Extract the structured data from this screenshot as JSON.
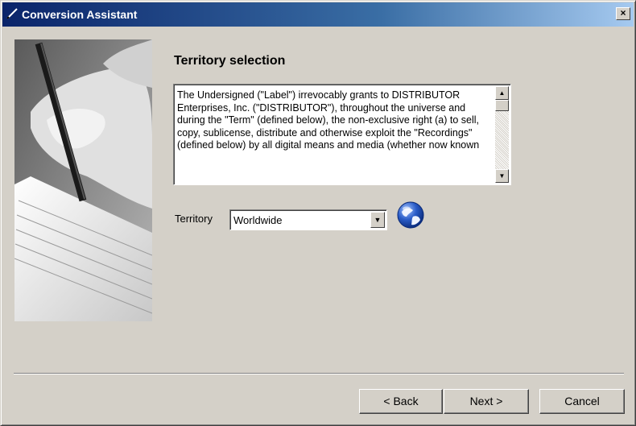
{
  "window": {
    "title": "Conversion Assistant",
    "close_label": "×"
  },
  "page": {
    "heading": "Territory selection",
    "license_text": "The Undersigned (\"Label\") irrevocably grants to DISTRIBUTOR Enterprises, Inc. (\"DISTRIBUTOR\"), throughout the universe and during the \"Term\" (defined below), the non-exclusive right (a) to sell, copy, sublicense, distribute and otherwise exploit the \"Recordings\" (defined below) by all digital means and media (whether now known",
    "territory": {
      "label": "Territory",
      "selected_value": "Worldwide"
    }
  },
  "icons": {
    "title": "pen-icon",
    "globe": "globe-icon",
    "scroll_up": "up-arrow-icon",
    "scroll_down": "down-arrow-icon",
    "dropdown": "chevron-down-icon"
  },
  "buttons": {
    "back": "< Back",
    "next": "Next >",
    "cancel": "Cancel"
  },
  "colors": {
    "titlebar_start": "#0a246a",
    "titlebar_end": "#a6caf0",
    "face": "#d4d0c8"
  }
}
